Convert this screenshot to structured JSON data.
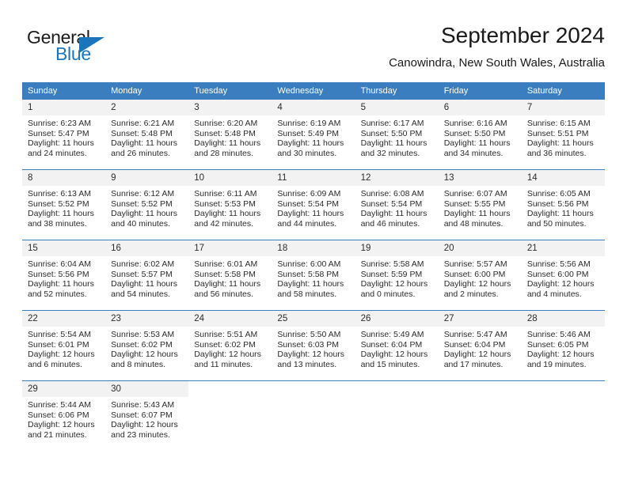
{
  "logo": {
    "word1": "General",
    "word2": "Blue",
    "triangle_color": "#1b75bb",
    "icon": "triangle-icon"
  },
  "header": {
    "title": "September 2024",
    "subtitle": "Canowindra, New South Wales, Australia"
  },
  "colors": {
    "header_blue": "#3a7ebf",
    "daynum_gray": "#f2f2f2",
    "text": "#2b2b2b",
    "logo_blue": "#1b75bb"
  },
  "weekdays": [
    "Sunday",
    "Monday",
    "Tuesday",
    "Wednesday",
    "Thursday",
    "Friday",
    "Saturday"
  ],
  "weeks": [
    [
      {
        "day": "1",
        "sunrise": "Sunrise: 6:23 AM",
        "sunset": "Sunset: 5:47 PM",
        "daylight1": "Daylight: 11 hours",
        "daylight2": "and 24 minutes."
      },
      {
        "day": "2",
        "sunrise": "Sunrise: 6:21 AM",
        "sunset": "Sunset: 5:48 PM",
        "daylight1": "Daylight: 11 hours",
        "daylight2": "and 26 minutes."
      },
      {
        "day": "3",
        "sunrise": "Sunrise: 6:20 AM",
        "sunset": "Sunset: 5:48 PM",
        "daylight1": "Daylight: 11 hours",
        "daylight2": "and 28 minutes."
      },
      {
        "day": "4",
        "sunrise": "Sunrise: 6:19 AM",
        "sunset": "Sunset: 5:49 PM",
        "daylight1": "Daylight: 11 hours",
        "daylight2": "and 30 minutes."
      },
      {
        "day": "5",
        "sunrise": "Sunrise: 6:17 AM",
        "sunset": "Sunset: 5:50 PM",
        "daylight1": "Daylight: 11 hours",
        "daylight2": "and 32 minutes."
      },
      {
        "day": "6",
        "sunrise": "Sunrise: 6:16 AM",
        "sunset": "Sunset: 5:50 PM",
        "daylight1": "Daylight: 11 hours",
        "daylight2": "and 34 minutes."
      },
      {
        "day": "7",
        "sunrise": "Sunrise: 6:15 AM",
        "sunset": "Sunset: 5:51 PM",
        "daylight1": "Daylight: 11 hours",
        "daylight2": "and 36 minutes."
      }
    ],
    [
      {
        "day": "8",
        "sunrise": "Sunrise: 6:13 AM",
        "sunset": "Sunset: 5:52 PM",
        "daylight1": "Daylight: 11 hours",
        "daylight2": "and 38 minutes."
      },
      {
        "day": "9",
        "sunrise": "Sunrise: 6:12 AM",
        "sunset": "Sunset: 5:52 PM",
        "daylight1": "Daylight: 11 hours",
        "daylight2": "and 40 minutes."
      },
      {
        "day": "10",
        "sunrise": "Sunrise: 6:11 AM",
        "sunset": "Sunset: 5:53 PM",
        "daylight1": "Daylight: 11 hours",
        "daylight2": "and 42 minutes."
      },
      {
        "day": "11",
        "sunrise": "Sunrise: 6:09 AM",
        "sunset": "Sunset: 5:54 PM",
        "daylight1": "Daylight: 11 hours",
        "daylight2": "and 44 minutes."
      },
      {
        "day": "12",
        "sunrise": "Sunrise: 6:08 AM",
        "sunset": "Sunset: 5:54 PM",
        "daylight1": "Daylight: 11 hours",
        "daylight2": "and 46 minutes."
      },
      {
        "day": "13",
        "sunrise": "Sunrise: 6:07 AM",
        "sunset": "Sunset: 5:55 PM",
        "daylight1": "Daylight: 11 hours",
        "daylight2": "and 48 minutes."
      },
      {
        "day": "14",
        "sunrise": "Sunrise: 6:05 AM",
        "sunset": "Sunset: 5:56 PM",
        "daylight1": "Daylight: 11 hours",
        "daylight2": "and 50 minutes."
      }
    ],
    [
      {
        "day": "15",
        "sunrise": "Sunrise: 6:04 AM",
        "sunset": "Sunset: 5:56 PM",
        "daylight1": "Daylight: 11 hours",
        "daylight2": "and 52 minutes."
      },
      {
        "day": "16",
        "sunrise": "Sunrise: 6:02 AM",
        "sunset": "Sunset: 5:57 PM",
        "daylight1": "Daylight: 11 hours",
        "daylight2": "and 54 minutes."
      },
      {
        "day": "17",
        "sunrise": "Sunrise: 6:01 AM",
        "sunset": "Sunset: 5:58 PM",
        "daylight1": "Daylight: 11 hours",
        "daylight2": "and 56 minutes."
      },
      {
        "day": "18",
        "sunrise": "Sunrise: 6:00 AM",
        "sunset": "Sunset: 5:58 PM",
        "daylight1": "Daylight: 11 hours",
        "daylight2": "and 58 minutes."
      },
      {
        "day": "19",
        "sunrise": "Sunrise: 5:58 AM",
        "sunset": "Sunset: 5:59 PM",
        "daylight1": "Daylight: 12 hours",
        "daylight2": "and 0 minutes."
      },
      {
        "day": "20",
        "sunrise": "Sunrise: 5:57 AM",
        "sunset": "Sunset: 6:00 PM",
        "daylight1": "Daylight: 12 hours",
        "daylight2": "and 2 minutes."
      },
      {
        "day": "21",
        "sunrise": "Sunrise: 5:56 AM",
        "sunset": "Sunset: 6:00 PM",
        "daylight1": "Daylight: 12 hours",
        "daylight2": "and 4 minutes."
      }
    ],
    [
      {
        "day": "22",
        "sunrise": "Sunrise: 5:54 AM",
        "sunset": "Sunset: 6:01 PM",
        "daylight1": "Daylight: 12 hours",
        "daylight2": "and 6 minutes."
      },
      {
        "day": "23",
        "sunrise": "Sunrise: 5:53 AM",
        "sunset": "Sunset: 6:02 PM",
        "daylight1": "Daylight: 12 hours",
        "daylight2": "and 8 minutes."
      },
      {
        "day": "24",
        "sunrise": "Sunrise: 5:51 AM",
        "sunset": "Sunset: 6:02 PM",
        "daylight1": "Daylight: 12 hours",
        "daylight2": "and 11 minutes."
      },
      {
        "day": "25",
        "sunrise": "Sunrise: 5:50 AM",
        "sunset": "Sunset: 6:03 PM",
        "daylight1": "Daylight: 12 hours",
        "daylight2": "and 13 minutes."
      },
      {
        "day": "26",
        "sunrise": "Sunrise: 5:49 AM",
        "sunset": "Sunset: 6:04 PM",
        "daylight1": "Daylight: 12 hours",
        "daylight2": "and 15 minutes."
      },
      {
        "day": "27",
        "sunrise": "Sunrise: 5:47 AM",
        "sunset": "Sunset: 6:04 PM",
        "daylight1": "Daylight: 12 hours",
        "daylight2": "and 17 minutes."
      },
      {
        "day": "28",
        "sunrise": "Sunrise: 5:46 AM",
        "sunset": "Sunset: 6:05 PM",
        "daylight1": "Daylight: 12 hours",
        "daylight2": "and 19 minutes."
      }
    ],
    [
      {
        "day": "29",
        "sunrise": "Sunrise: 5:44 AM",
        "sunset": "Sunset: 6:06 PM",
        "daylight1": "Daylight: 12 hours",
        "daylight2": "and 21 minutes."
      },
      {
        "day": "30",
        "sunrise": "Sunrise: 5:43 AM",
        "sunset": "Sunset: 6:07 PM",
        "daylight1": "Daylight: 12 hours",
        "daylight2": "and 23 minutes."
      },
      null,
      null,
      null,
      null,
      null
    ]
  ]
}
